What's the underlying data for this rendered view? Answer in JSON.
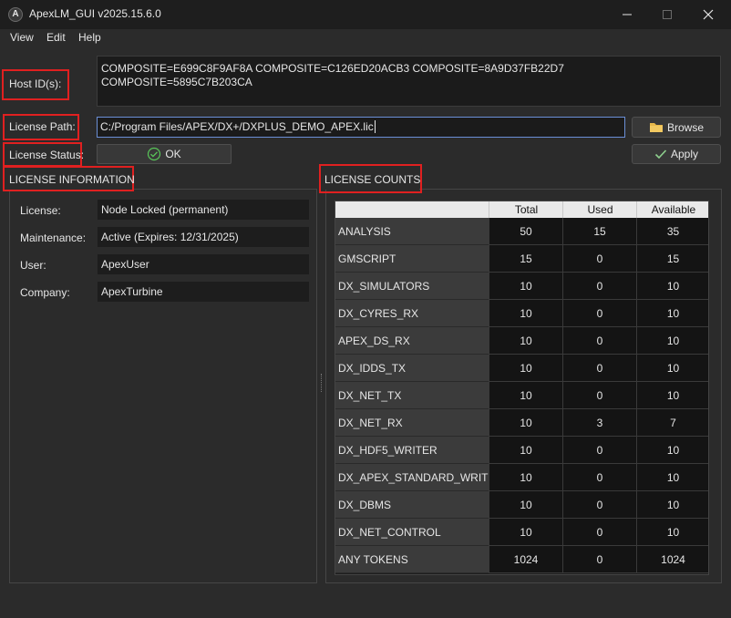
{
  "window": {
    "title": "ApexLM_GUI v2025.15.6.0",
    "icon_letter": "A"
  },
  "menu": {
    "items": [
      "View",
      "Edit",
      "Help"
    ]
  },
  "host": {
    "label": "Host ID(s):",
    "value": "COMPOSITE=E699C8F9AF8A COMPOSITE=C126ED20ACB3 COMPOSITE=8A9D37FB22D7 COMPOSITE=5895C7B203CA"
  },
  "license_path": {
    "label": "License Path:",
    "value": "C:/Program Files/APEX/DX+/DXPLUS_DEMO_APEX.lic",
    "browse_label": "Browse"
  },
  "license_status": {
    "label": "License Status:",
    "status": "OK",
    "apply_label": "Apply"
  },
  "info": {
    "title": "LICENSE INFORMATION",
    "rows": [
      {
        "label": "License:",
        "value": "Node Locked (permanent)"
      },
      {
        "label": "Maintenance:",
        "value": "Active (Expires: 12/31/2025)"
      },
      {
        "label": "User:",
        "value": "ApexUser"
      },
      {
        "label": "Company:",
        "value": "ApexTurbine"
      }
    ]
  },
  "counts": {
    "title": "LICENSE COUNTS",
    "headers": [
      "Total",
      "Used",
      "Available"
    ],
    "rows": [
      {
        "name": "ANALYSIS",
        "total": "50",
        "used": "15",
        "available": "35"
      },
      {
        "name": "GMSCRIPT",
        "total": "15",
        "used": "0",
        "available": "15"
      },
      {
        "name": "DX_SIMULATORS",
        "total": "10",
        "used": "0",
        "available": "10"
      },
      {
        "name": "DX_CYRES_RX",
        "total": "10",
        "used": "0",
        "available": "10"
      },
      {
        "name": "APEX_DS_RX",
        "total": "10",
        "used": "0",
        "available": "10"
      },
      {
        "name": "DX_IDDS_TX",
        "total": "10",
        "used": "0",
        "available": "10"
      },
      {
        "name": "DX_NET_TX",
        "total": "10",
        "used": "0",
        "available": "10"
      },
      {
        "name": "DX_NET_RX",
        "total": "10",
        "used": "3",
        "available": "7"
      },
      {
        "name": "DX_HDF5_WRITER",
        "total": "10",
        "used": "0",
        "available": "10"
      },
      {
        "name": "DX_APEX_STANDARD_WRITE",
        "total": "10",
        "used": "0",
        "available": "10"
      },
      {
        "name": "DX_DBMS",
        "total": "10",
        "used": "0",
        "available": "10"
      },
      {
        "name": "DX_NET_CONTROL",
        "total": "10",
        "used": "0",
        "available": "10"
      },
      {
        "name": "ANY TOKENS",
        "total": "1024",
        "used": "0",
        "available": "1024"
      }
    ]
  },
  "colors": {
    "highlight": "#e02020",
    "ok_icon": "#59c659",
    "apply_icon": "#8fd18f",
    "folder": "#e8b84a"
  }
}
